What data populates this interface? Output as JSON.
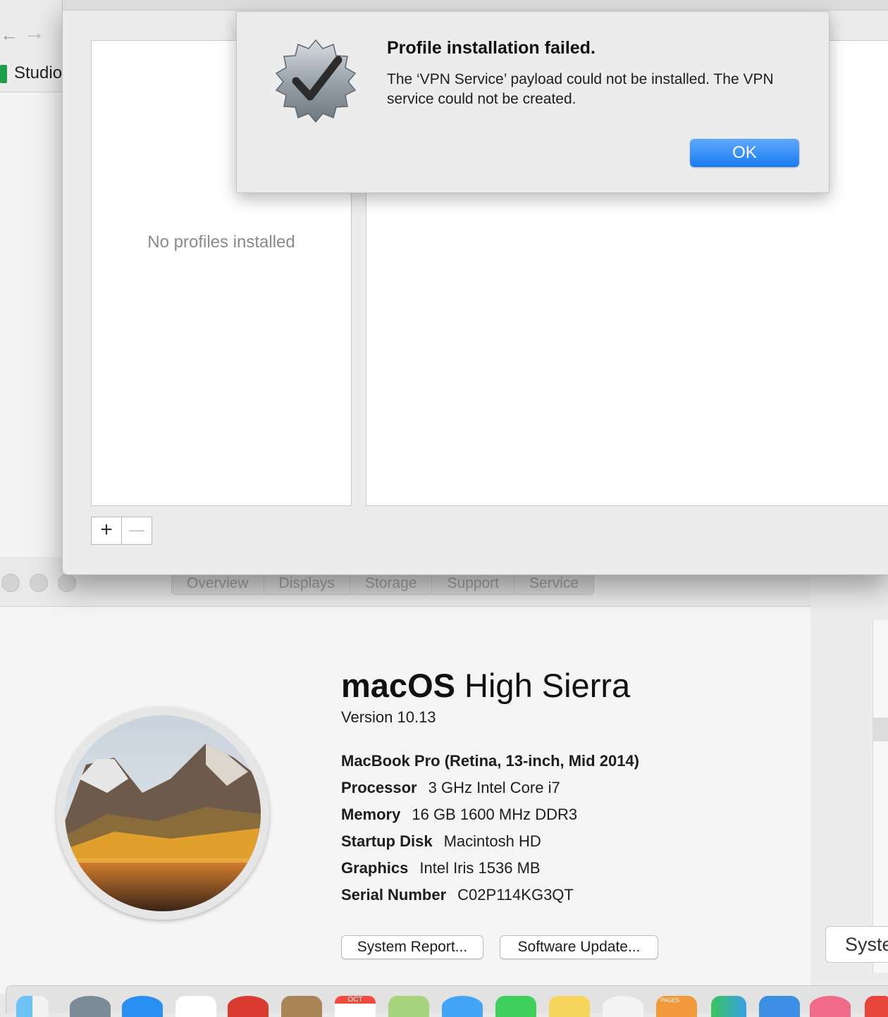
{
  "browser": {
    "back_glyph": "←",
    "forward_glyph": "→",
    "tab_label": "Studio"
  },
  "about_window": {
    "tabs": [
      "Overview",
      "Displays",
      "Storage",
      "Support",
      "Service"
    ],
    "os_name_bold": "macOS",
    "os_name_rest": "High Sierra",
    "version": "Version 10.13",
    "model": "MacBook Pro (Retina, 13-inch, Mid 2014)",
    "specs": [
      {
        "key": "Processor",
        "value": "3 GHz Intel Core i7"
      },
      {
        "key": "Memory",
        "value": "16 GB 1600 MHz DDR3"
      },
      {
        "key": "Startup Disk",
        "value": "Macintosh HD"
      },
      {
        "key": "Graphics",
        "value": "Intel Iris 1536 MB"
      },
      {
        "key": "Serial Number",
        "value": "C02P114KG3QT"
      }
    ],
    "system_report_label": "System Report...",
    "software_update_label": "Software Update..."
  },
  "right_window": {
    "button_label": "Syste"
  },
  "profiles_window": {
    "empty_text": "No profiles installed",
    "add_glyph": "+",
    "remove_glyph": "—"
  },
  "alert": {
    "title": "Profile installation failed.",
    "message": "The ‘VPN Service’ payload could not be installed. The VPN service could not be created.",
    "ok_label": "OK",
    "accent_color": "#1a7cf2"
  },
  "dock": {
    "icons": [
      "finder-icon",
      "launchpad-icon",
      "safari-icon",
      "app-grid-icon",
      "chrome-icon",
      "contacts-icon",
      "calendar-icon",
      "maps-icon",
      "messages-icon",
      "facetime-icon",
      "notes-icon",
      "photos-icon",
      "pages-icon",
      "numbers-icon",
      "keynote-icon",
      "itunes-icon",
      "app-icon"
    ],
    "calendar_month": "OCT",
    "pages_label": "PAGES"
  }
}
